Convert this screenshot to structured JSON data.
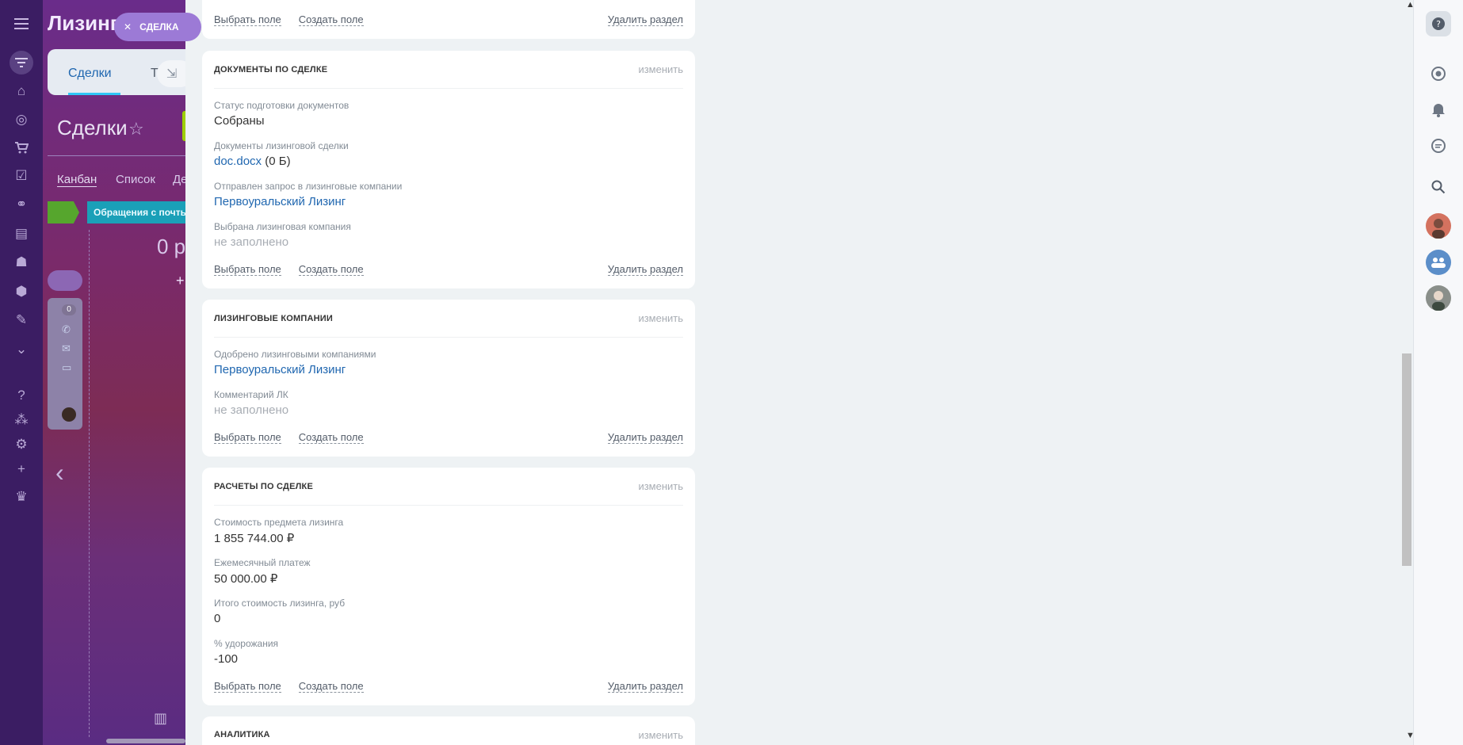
{
  "bg_page": {
    "portal_title": "Лизинг",
    "deal_pill_label": "СДЕЛКА",
    "tab_deals": "Сделки",
    "tab_t": "Т",
    "page_title": "Сделки",
    "view_kanban": "Канбан",
    "view_list": "Список",
    "view_d": "Де",
    "stage_name": "Обращения с почты",
    "stage_sum": "0 р",
    "card_badge": "0"
  },
  "colors": {
    "link": "#2067b0",
    "panel_bg": "#eef2f4",
    "accent_purple": "#9c7ad6"
  },
  "sections": [
    {
      "edit_label": "",
      "footer": {
        "choose_field": "Выбрать поле",
        "create_field": "Создать поле",
        "delete_section": "Удалить раздел"
      }
    },
    {
      "title": "ДОКУМЕНТЫ ПО СДЕЛКЕ",
      "edit_label": "изменить",
      "fields": [
        {
          "label": "Статус подготовки документов",
          "value": "Собраны"
        },
        {
          "label": "Документы лизинговой сделки",
          "value": "doc.docx",
          "suffix": " (0 Б)"
        },
        {
          "label": "Отправлен запрос в лизинговые компании",
          "value": "Первоуральский Лизинг"
        },
        {
          "label": "Выбрана лизинговая компания",
          "value": "не заполнено"
        }
      ],
      "footer": {
        "choose_field": "Выбрать поле",
        "create_field": "Создать поле",
        "delete_section": "Удалить раздел"
      }
    },
    {
      "title": "ЛИЗИНГОВЫЕ КОМПАНИИ",
      "edit_label": "изменить",
      "fields": [
        {
          "label": "Одобрено лизинговыми компаниями",
          "value": "Первоуральский Лизинг"
        },
        {
          "label": "Комментарий ЛК",
          "value": "не заполнено"
        }
      ],
      "footer": {
        "choose_field": "Выбрать поле",
        "create_field": "Создать поле",
        "delete_section": "Удалить раздел"
      }
    },
    {
      "title": "РАСЧЕТЫ ПО СДЕЛКЕ",
      "edit_label": "изменить",
      "fields": [
        {
          "label": "Стоимость предмета лизинга",
          "value": "1 855 744.00 ₽"
        },
        {
          "label": "Ежемесячный платеж",
          "value": "50 000.00 ₽"
        },
        {
          "label": "Итого стоимость лизинга, руб",
          "value": "0"
        },
        {
          "label": "% удорожания",
          "value": "-100"
        }
      ],
      "footer": {
        "choose_field": "Выбрать поле",
        "create_field": "Создать поле",
        "delete_section": "Удалить раздел"
      }
    },
    {
      "title": "АНАЛИТИКА",
      "edit_label": "изменить"
    }
  ],
  "left_rail_icons": [
    "menu-icon",
    "filter-icon",
    "bank-icon",
    "target-icon",
    "cart-icon",
    "tasks-icon",
    "sites-icon",
    "contact-card-icon",
    "robot-icon",
    "box-icon",
    "signature-icon",
    "more-icon",
    "help-icon",
    "org-structure-icon",
    "settings-icon",
    "plus-icon",
    "crown-icon"
  ],
  "right_rail_icons": [
    "help-icon",
    "copilot-icon",
    "bell-icon",
    "chat-icon",
    "search-icon",
    "user-avatar",
    "group-chat-avatar",
    "user-avatar-2"
  ]
}
